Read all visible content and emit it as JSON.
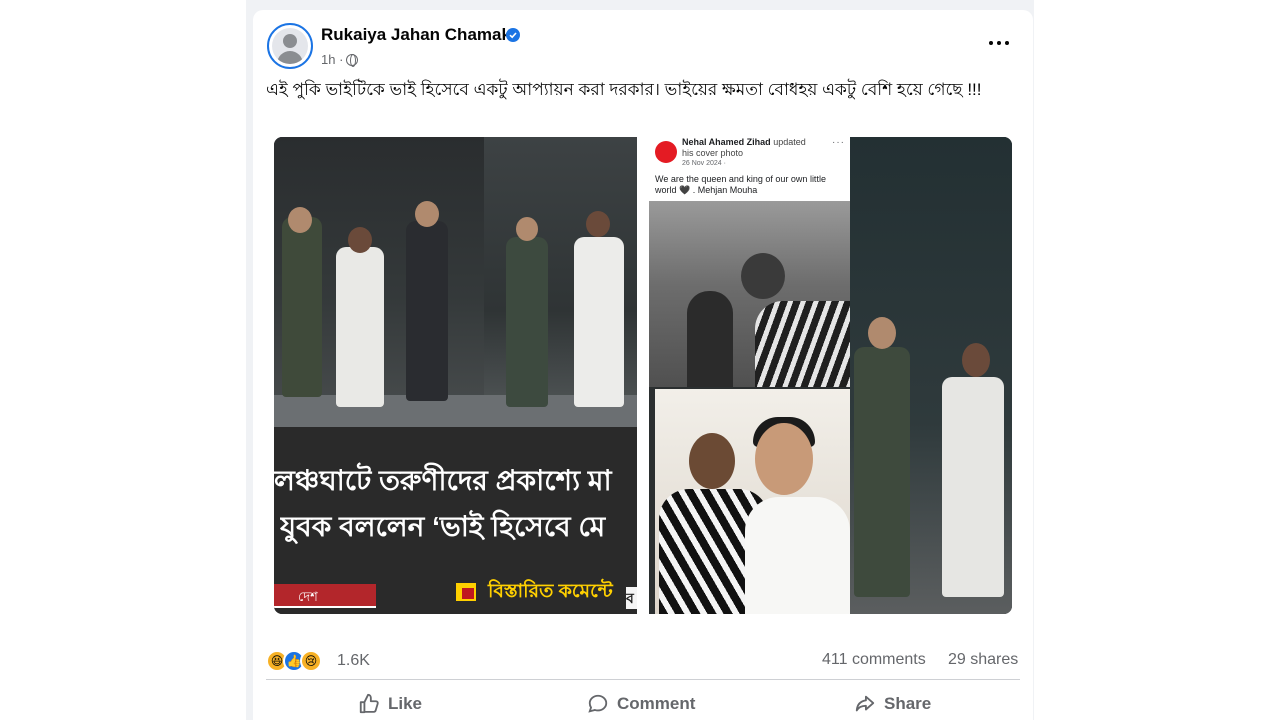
{
  "post": {
    "author": "Rukaiya Jahan Chamak",
    "time": "1h ·",
    "text": "এই পুকি ভাইটিকে ভাই হিসেবে একটু আপ্যায়ন করা দরকার। ভাইয়ের ক্ষমতা বোধহয় একটু বেশি হয়ে গেছে !!!"
  },
  "media": {
    "left": {
      "caption_line1": "লঞ্চঘাটে তরুণীদের প্রকাশ্যে মা",
      "caption_line2": "যুবক বললেন ‘ভাই হিসেবে মে",
      "tag": "দেশ",
      "more_in_comment": "বিস্তারিত কমেন্টে",
      "edge_letter": "ব"
    },
    "fb_card": {
      "name": "Nehal Ahamed Zihad",
      "action": "updated his cover photo",
      "date": "26 Nov 2024 ·",
      "dots": "···",
      "body": "We are the queen and king of our own little world 🖤 . Mehjan Mouha"
    }
  },
  "stats": {
    "reaction_count": "1.6K",
    "comments": "411 comments",
    "shares": "29 shares"
  },
  "actions": {
    "like": "Like",
    "comment": "Comment",
    "share": "Share"
  },
  "icons": {
    "reactions": [
      "haha-icon",
      "like-icon",
      "sad-icon"
    ]
  },
  "colors": {
    "accent": "#1b74e4",
    "muted_text": "#65676b"
  }
}
